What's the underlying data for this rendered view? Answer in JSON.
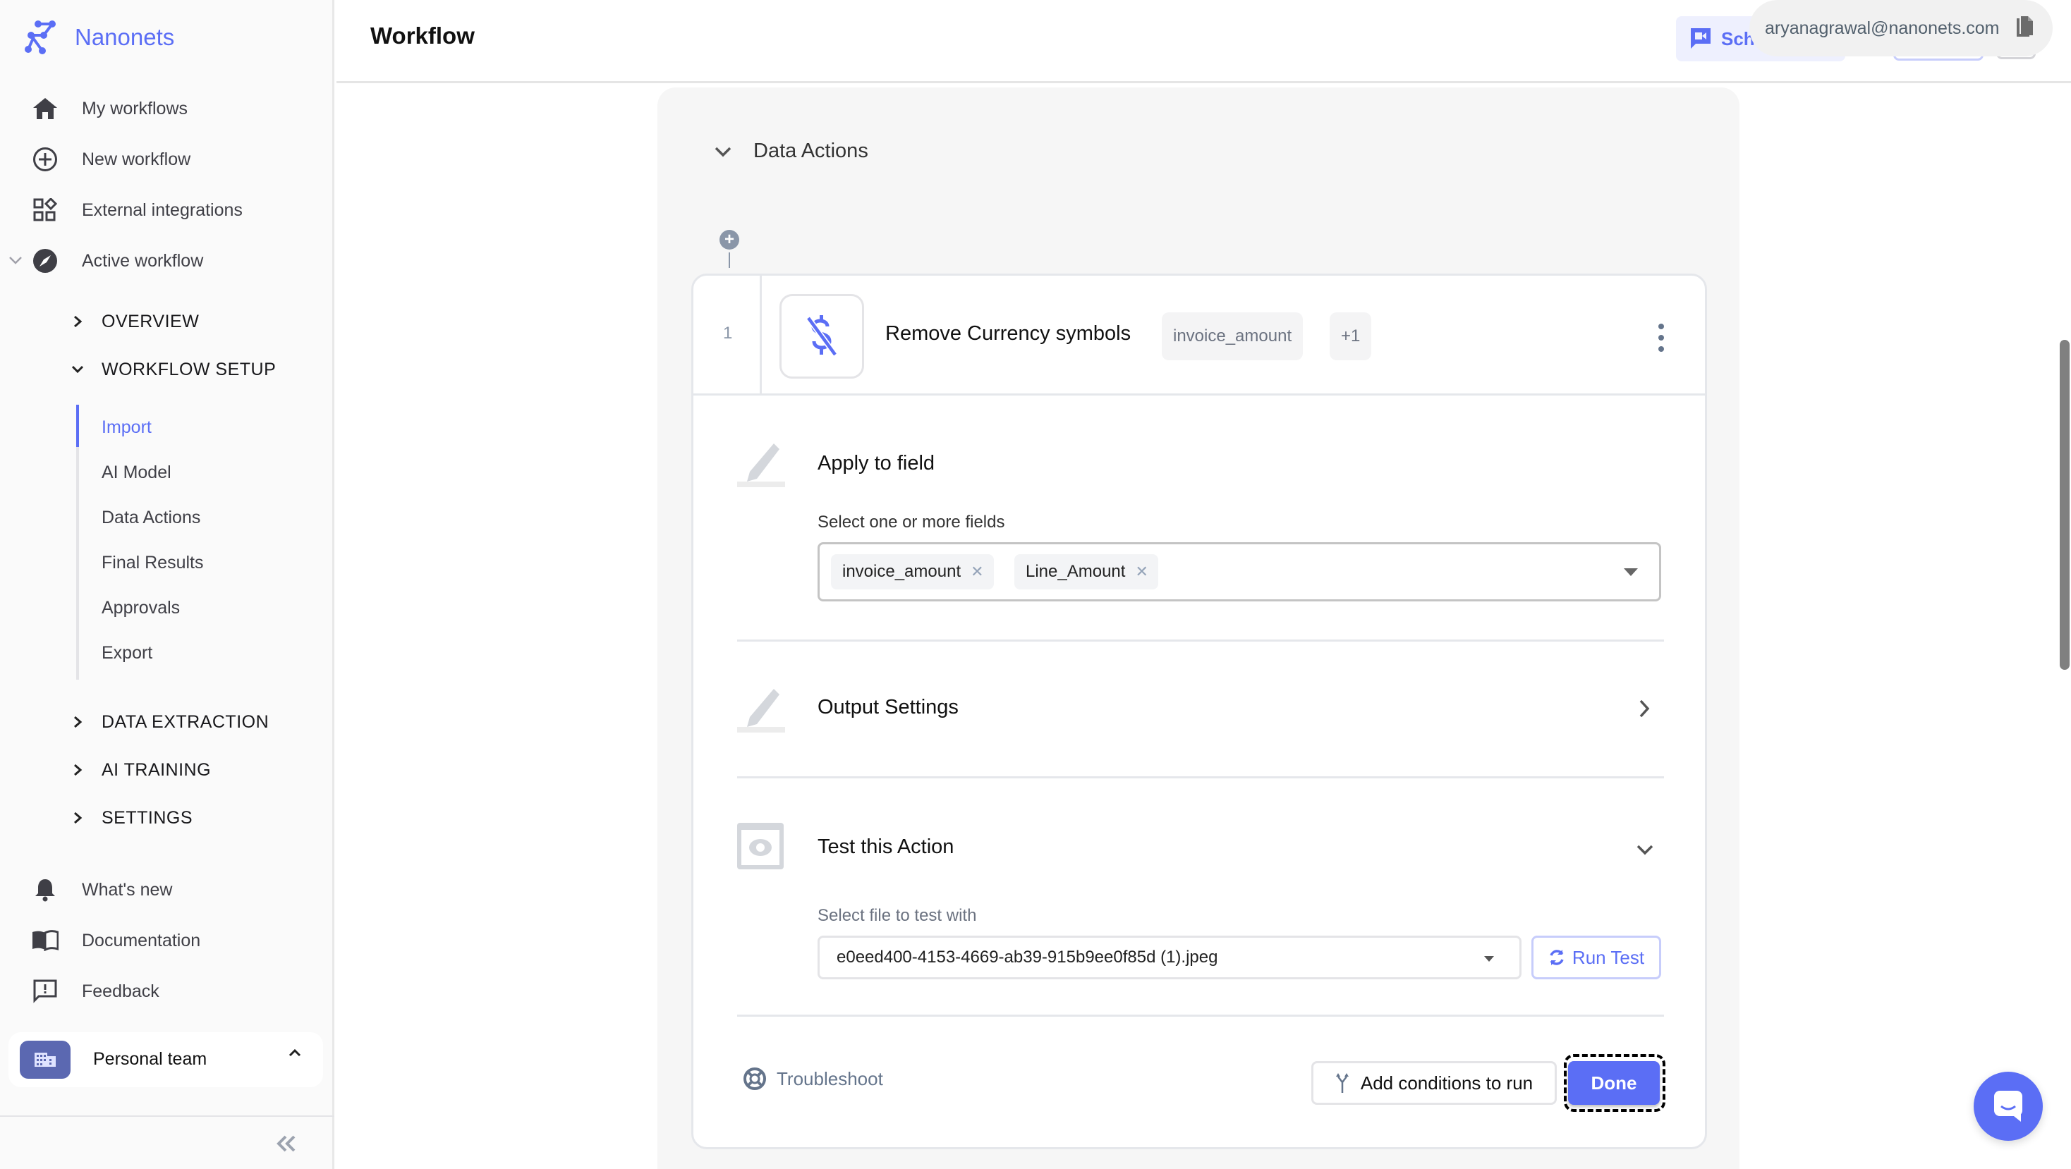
{
  "brand": {
    "name": "Nanonets",
    "accent": "#5b6ef5"
  },
  "sidebar": {
    "nav": [
      {
        "label": "My workflows",
        "icon": "home-icon"
      },
      {
        "label": "New workflow",
        "icon": "plus-circle-icon"
      },
      {
        "label": "External integrations",
        "icon": "widgets-icon"
      },
      {
        "label": "Active workflow",
        "icon": "compass-icon",
        "expanded": true
      }
    ],
    "sections": [
      {
        "label": "OVERVIEW",
        "expanded": false
      },
      {
        "label": "WORKFLOW SETUP",
        "expanded": true
      },
      {
        "label": "DATA EXTRACTION",
        "expanded": false
      },
      {
        "label": "AI TRAINING",
        "expanded": false
      },
      {
        "label": "SETTINGS",
        "expanded": false
      }
    ],
    "workflow_setup_items": [
      {
        "label": "Import",
        "active": true
      },
      {
        "label": "AI Model"
      },
      {
        "label": "Data Actions"
      },
      {
        "label": "Final Results"
      },
      {
        "label": "Approvals"
      },
      {
        "label": "Export"
      }
    ],
    "footer_nav": [
      {
        "label": "What's new",
        "icon": "bell-icon"
      },
      {
        "label": "Documentation",
        "icon": "book-icon"
      },
      {
        "label": "Feedback",
        "icon": "feedback-icon"
      }
    ],
    "team": {
      "name": "Personal team"
    }
  },
  "header": {
    "title": "Workflow",
    "schedule_button_label": "Sch",
    "user_email": "aryanagrawal@nanonets.com"
  },
  "panel": {
    "title": "Data Actions",
    "action": {
      "step_number": "1",
      "title": "Remove Currency symbols",
      "chips": [
        "invoice_amount",
        "+1"
      ],
      "apply_to_field": {
        "title": "Apply to field",
        "label": "Select one or more fields",
        "selected": [
          "invoice_amount",
          "Line_Amount"
        ]
      },
      "output_settings": {
        "title": "Output Settings"
      },
      "test": {
        "title": "Test this Action",
        "label": "Select file to test with",
        "file": "e0eed400-4153-4669-ab39-915b9ee0f85d (1).jpeg",
        "run_label": "Run Test"
      },
      "footer": {
        "troubleshoot_label": "Troubleshoot",
        "conditions_label": "Add conditions to run",
        "done_label": "Done"
      }
    }
  }
}
